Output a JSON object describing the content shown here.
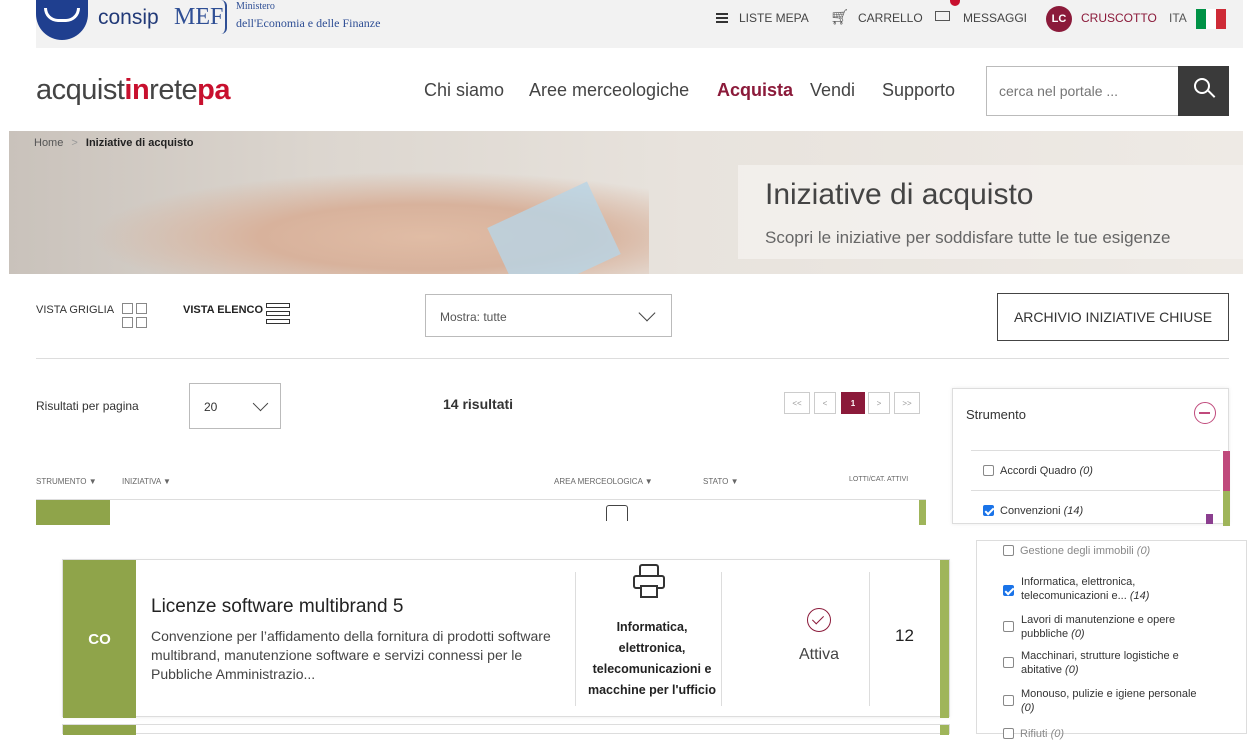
{
  "topbar": {
    "consip": "consip",
    "mef": "MEF",
    "ministero_line1": "Ministero",
    "ministero_line2": "dell'Economia e delle Finanze",
    "liste_mepa": "LISTE MEPA",
    "carrello": "CARRELLO",
    "messaggi": "MESSAGGI",
    "avatar_initials": "LC",
    "cruscotto": "CRUSCOTTO",
    "lang": "ITA"
  },
  "nav": {
    "logo_a": "acquist",
    "logo_b": "in",
    "logo_c": "rete",
    "logo_d": "pa",
    "items": [
      "Chi siamo",
      "Aree merceologiche",
      "Acquista",
      "Vendi",
      "Supporto"
    ],
    "search_placeholder": "cerca nel portale ..."
  },
  "breadcrumb": {
    "home": "Home",
    "current": "Iniziative di acquisto"
  },
  "hero": {
    "title": "Iniziative di acquisto",
    "subtitle": "Scopri le iniziative per soddisfare tutte le tue esigenze"
  },
  "controls": {
    "vista_griglia": "VISTA GRIGLIA",
    "vista_elenco": "VISTA ELENCO",
    "mostra": "Mostra: tutte",
    "archivio": "ARCHIVIO INIZIATIVE CHIUSE",
    "risultati_label": "Risultati per pagina",
    "per_page": "20",
    "count": "14 risultati",
    "pager": [
      "<<",
      "<",
      "1",
      ">",
      ">>"
    ]
  },
  "table_headers": {
    "strumento": "STRUMENTO",
    "iniziativa": "INIZIATIVA",
    "area": "AREA MERCEOLOGICA",
    "stato": "STATO",
    "lotti": "LOTTI/CAT. ATTIVI"
  },
  "sidebar": {
    "title": "Strumento",
    "strumento_items": [
      {
        "label": "Accordi Quadro",
        "count": "(0)",
        "checked": false,
        "accent": "#c04a7c"
      },
      {
        "label": "Convenzioni",
        "count": "(14)",
        "checked": true,
        "accent": "#9fb55a"
      }
    ],
    "area_items": [
      {
        "label": "Gestione degli immobili",
        "count": "(0)",
        "checked": false
      },
      {
        "label": "Informatica, elettronica, telecomunicazioni e...",
        "count": "(14)",
        "checked": true
      },
      {
        "label": "Lavori di manutenzione e opere pubbliche",
        "count": "(0)",
        "checked": false
      },
      {
        "label": "Macchinari, strutture logistiche e abitative",
        "count": "(0)",
        "checked": false
      },
      {
        "label": "Monouso, pulizie e igiene personale",
        "count": "(0)",
        "checked": false
      },
      {
        "label": "Rifiuti",
        "count": "(0)",
        "checked": false
      }
    ]
  },
  "result": {
    "badge": "CO",
    "title": "Licenze software multibrand 5",
    "description": "Convenzione per l’affidamento della fornitura di prodotti software multibrand, manutenzione software e servizi connessi per le Pubbliche Amministrazio...",
    "area": "Informatica, elettronica, telecomunicazioni e macchine per l'ufficio",
    "status": "Attiva",
    "lotti": "12"
  },
  "colors": {
    "brand_red": "#c8102e",
    "accent_green": "#9fb55a",
    "accent_purple": "#8b3e8f",
    "dark": "#3a3a3a"
  }
}
